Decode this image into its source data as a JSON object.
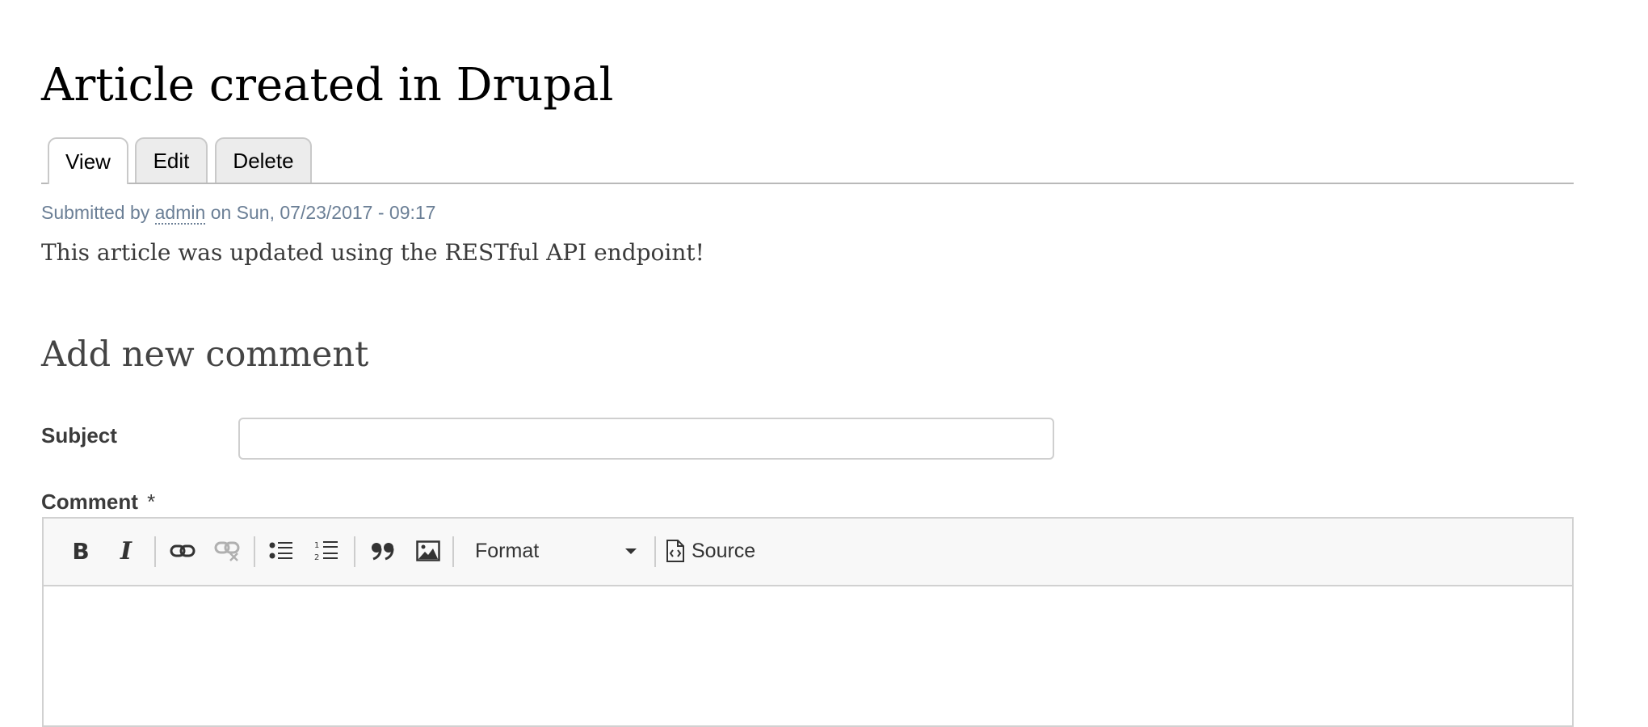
{
  "page": {
    "title": "Article created in Drupal"
  },
  "tabs": [
    {
      "label": "View",
      "active": true
    },
    {
      "label": "Edit",
      "active": false
    },
    {
      "label": "Delete",
      "active": false
    }
  ],
  "meta": {
    "prefix": "Submitted by",
    "author": "admin",
    "suffix": "on Sun, 07/23/2017 - 09:17"
  },
  "article": {
    "body": "This article was updated using the RESTful API endpoint!"
  },
  "comment_form": {
    "heading": "Add new comment",
    "subject_label": "Subject",
    "subject_value": "",
    "comment_label": "Comment",
    "required_marker": "*",
    "toolbar": {
      "bold_label": "B",
      "italic_label": "I",
      "format_label": "Format",
      "source_label": "Source",
      "icons": [
        "bold-icon",
        "italic-icon",
        "link-icon",
        "unlink-icon",
        "bulleted-list-icon",
        "numbered-list-icon",
        "blockquote-icon",
        "image-icon",
        "source-icon"
      ]
    }
  },
  "colors": {
    "meta_text": "#6b7f96",
    "body_text": "#3b3b3b",
    "tab_bg": "#ececec",
    "toolbar_bg": "#f8f8f8"
  }
}
